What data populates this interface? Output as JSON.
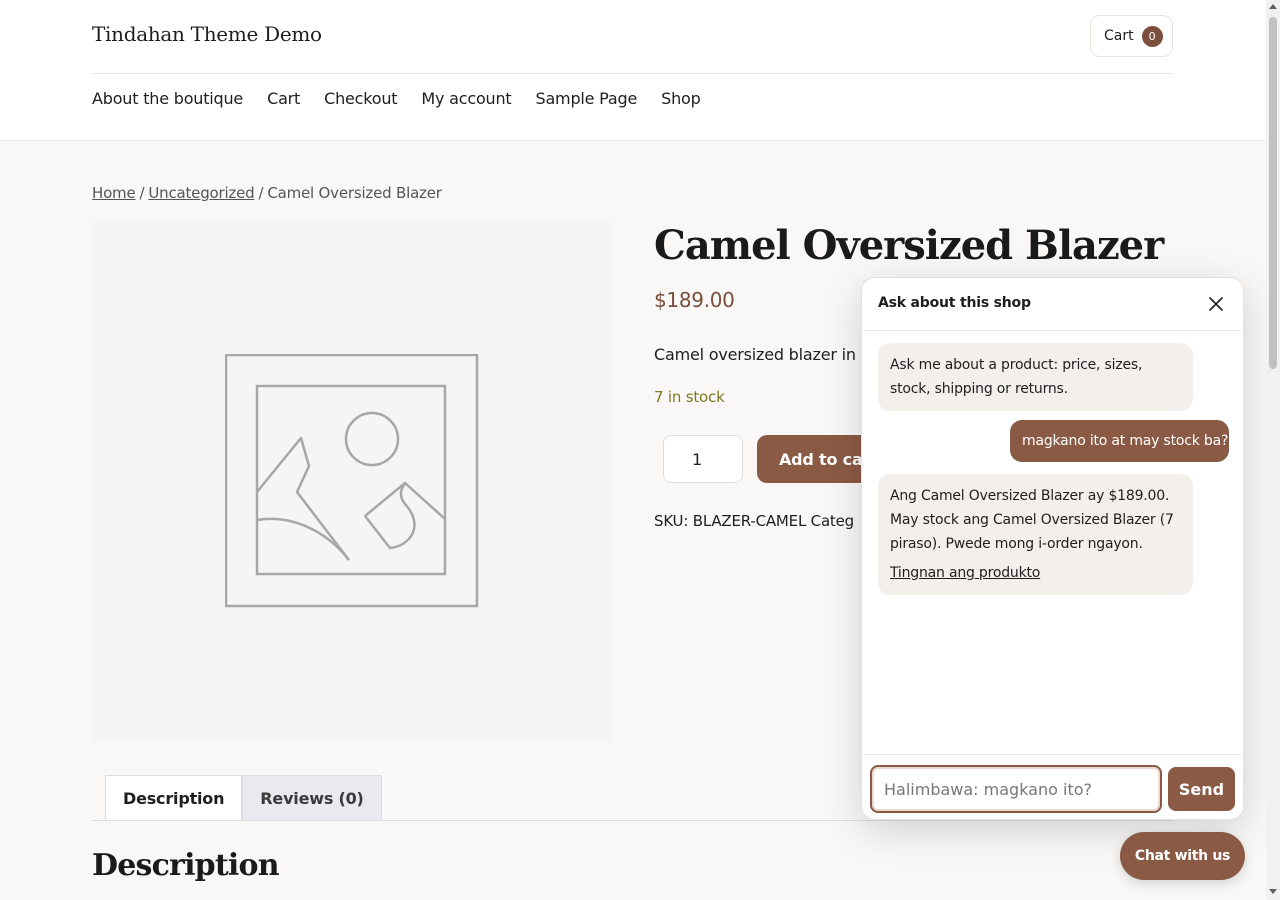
{
  "header": {
    "site_title": "Tindahan Theme Demo",
    "cart_label": "Cart",
    "cart_count": "0",
    "nav": [
      "About the boutique",
      "Cart",
      "Checkout",
      "My account",
      "Sample Page",
      "Shop"
    ]
  },
  "breadcrumb": {
    "home": "Home",
    "category": "Uncategorized",
    "current": "Camel Oversized Blazer",
    "separator": "/"
  },
  "product": {
    "image_icon": "image-placeholder-icon",
    "title": "Camel Oversized Blazer",
    "price": "$189.00",
    "short_description": "Camel oversized blazer in a",
    "stock": "7 in stock",
    "quantity": "1",
    "add_to_cart_label": "Add to cart",
    "meta": "SKU: BLAZER-CAMEL Categ"
  },
  "tabs": [
    {
      "label": "Description",
      "active": true
    },
    {
      "label": "Reviews (0)",
      "active": false
    }
  ],
  "description_heading": "Description",
  "chat": {
    "title": "Ask about this shop",
    "close_icon": "close-icon",
    "messages": [
      {
        "role": "bot",
        "text": "Ask me about a product: price, sizes, stock, shipping or returns."
      },
      {
        "role": "user",
        "text": "magkano ito at may stock ba?"
      },
      {
        "role": "bot",
        "text": "Ang Camel Oversized Blazer ay $189.00. May stock ang Camel Oversized Blazer (7 piraso). Pwede mong i-order ngayon.",
        "link": "Tingnan ang produkto"
      }
    ],
    "input_placeholder": "Halimbawa: magkano ito?",
    "send_label": "Send",
    "launcher_label": "Chat with us"
  },
  "colors": {
    "accent": "#8b5a45",
    "price": "#7a4f3d",
    "stock": "#7d7a21",
    "background": "#f9f8f6"
  }
}
